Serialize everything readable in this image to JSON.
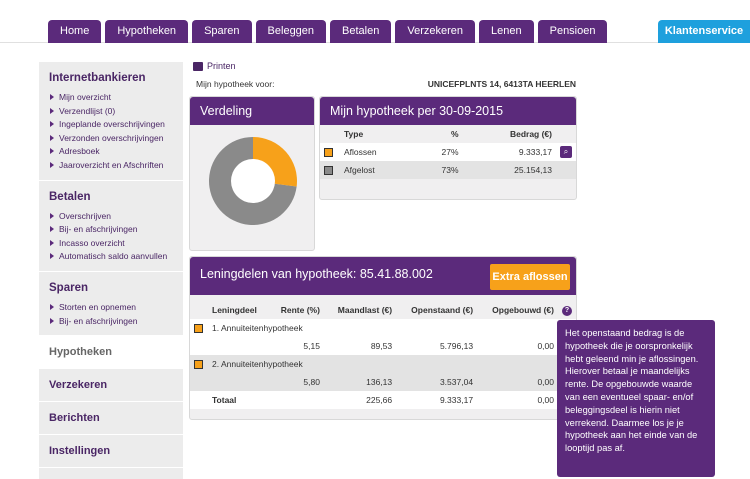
{
  "nav": {
    "tabs": [
      "Home",
      "Hypotheken",
      "Sparen",
      "Beleggen",
      "Betalen",
      "Verzekeren",
      "Lenen",
      "Pensioen"
    ],
    "klantenservice": "Klantenservice"
  },
  "sidebar": {
    "internetbankieren": {
      "title": "Internetbankieren",
      "items": [
        "Mijn overzicht",
        "Verzendlijst  (0)",
        "Ingeplande overschrijvingen",
        "Verzonden overschrijvingen",
        "Adresboek",
        "Jaaroverzicht en Afschriften"
      ]
    },
    "betalen": {
      "title": "Betalen",
      "items": [
        "Overschrijven",
        "Bij- en afschrijvingen",
        "Incasso overzicht",
        "Automatisch saldo aanvullen"
      ]
    },
    "sparen": {
      "title": "Sparen",
      "items": [
        "Storten en opnemen",
        "Bij- en afschrijvingen"
      ]
    },
    "plain": [
      "Hypotheken",
      "Verzekeren",
      "Berichten",
      "Instellingen"
    ]
  },
  "main": {
    "print_label": "Printen",
    "hyp_label": "Mijn hypotheek voor:",
    "hyp_address": "UNICEFPLNTS 14, 6413TA HEERLEN"
  },
  "verdeling": {
    "title": "Verdeling",
    "chart_colors": {
      "aflossen": "#f7a11a",
      "afgelost": "#8a8a8a"
    },
    "aflossen_pct": 27,
    "afgelost_pct": 73
  },
  "hyp30": {
    "title": "Mijn hypotheek per 30-09-2015",
    "headers": {
      "type": "Type",
      "pct": "%",
      "bedrag": "Bedrag (€)"
    },
    "rows": [
      {
        "type": "Aflossen",
        "pct": "27%",
        "bedrag": "9.333,17"
      },
      {
        "type": "Afgelost",
        "pct": "73%",
        "bedrag": "25.154,13"
      }
    ]
  },
  "lening": {
    "title": "Leningdelen van hypotheek: 85.41.88.002",
    "extra_button": "Extra aflossen",
    "headers": {
      "leningdeel": "Leningdeel",
      "rente": "Rente (%)",
      "maandlast": "Maandlast (€)",
      "openstaand": "Openstaand (€)",
      "opgebouwd": "Opgebouwd (€)"
    },
    "rows": [
      {
        "name": "1. Annuiteitenhypotheek",
        "rente": "5,15",
        "maandlast": "89,53",
        "openstaand": "5.796,13",
        "opgebouwd": "0,00"
      },
      {
        "name": "2. Annuiteitenhypotheek",
        "rente": "5,80",
        "maandlast": "136,13",
        "openstaand": "3.537,04",
        "opgebouwd": "0,00"
      }
    ],
    "total": {
      "label": "Totaal",
      "maandlast": "225,66",
      "openstaand": "9.333,17",
      "opgebouwd": "0,00"
    }
  },
  "tooltip": {
    "text": "Het openstaand bedrag is de hypotheek die je oorspronkelijk hebt geleend min je aflossingen. Hierover betaal je maandelijks rente. De opgebouwde waarde van een eventueel spaar- en/of beleggingsdeel is hierin niet verrekend. Daarmee los je je hypotheek aan het einde van de looptijd pas af."
  }
}
